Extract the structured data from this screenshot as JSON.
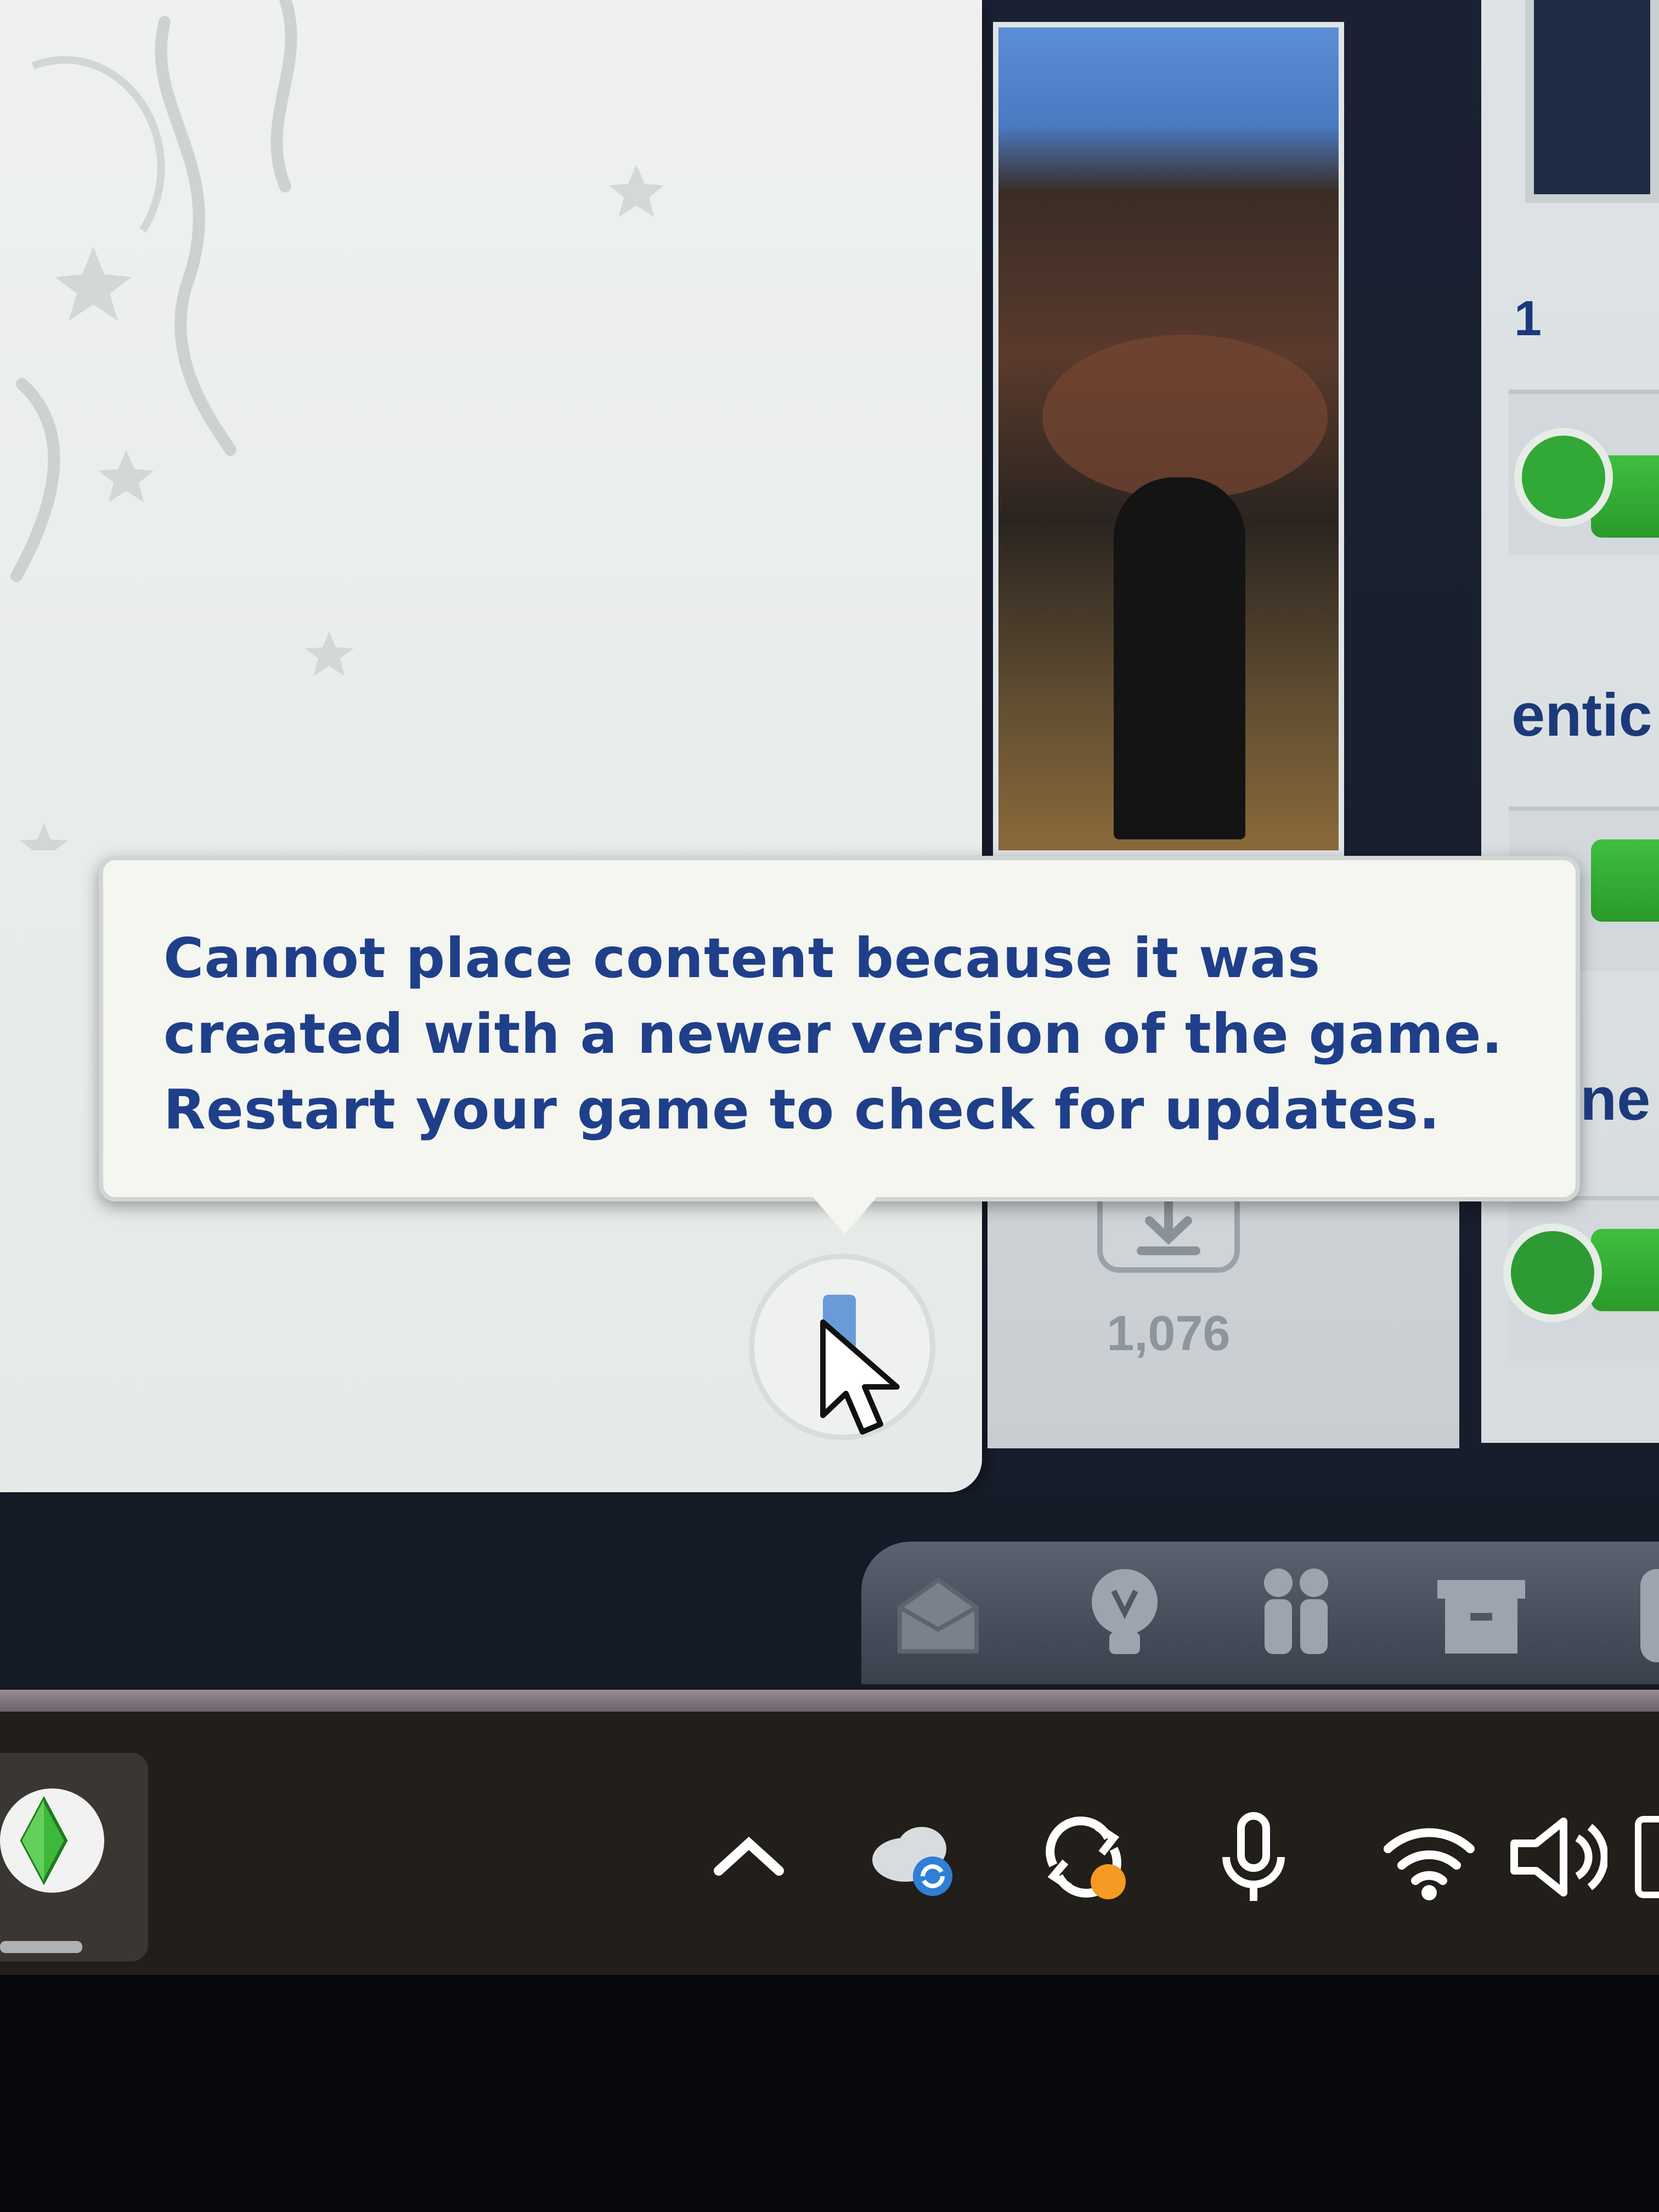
{
  "tooltip": {
    "line1": "Cannot place content because it was",
    "line2": "created with a newer version of the game.",
    "line3": "Restart your game to check for updates."
  },
  "item_card": {
    "downloads_count": "1,076"
  },
  "right_panel": {
    "number": "1",
    "word_partial_1": "entic",
    "word_partial_2": "ne"
  },
  "game_toolbar": {
    "icons": [
      "mailbox-icon",
      "lightbulb-icon",
      "household-icon",
      "storage-box-icon"
    ]
  },
  "taskbar": {
    "app": "sims-plumbob-icon",
    "tray_icons": [
      "show-hidden-icons-chevron",
      "onedrive-sync-icon",
      "sync-update-icon",
      "microphone-icon",
      "wifi-icon",
      "volume-icon"
    ]
  },
  "colors": {
    "tooltip_text": "#1f3f8a",
    "tooltip_bg": "#f4f6ef",
    "mood_green": "#32a836",
    "update_badge": "#f59a23"
  }
}
